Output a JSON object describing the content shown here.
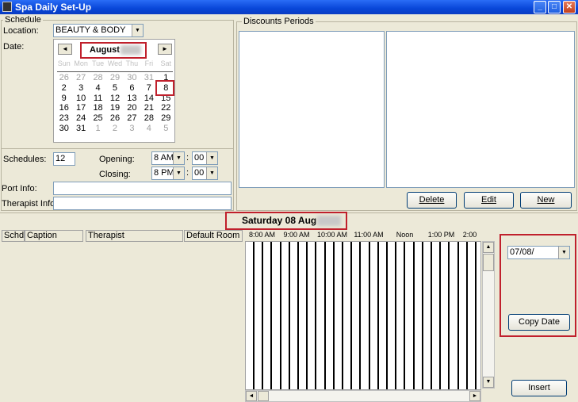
{
  "window": {
    "title": "Spa Daily Set-Up"
  },
  "schedule": {
    "group_label": "Schedule",
    "location_label": "Location:",
    "location_value": "BEAUTY & BODY",
    "date_label": "Date:",
    "calendar": {
      "month": "August",
      "dows": [
        "Sun",
        "Mon",
        "Tue",
        "Wed",
        "Thu",
        "Fri",
        "Sat"
      ],
      "days": [
        "26",
        "27",
        "28",
        "29",
        "30",
        "31",
        "1",
        "2",
        "3",
        "4",
        "5",
        "6",
        "7",
        "8",
        "9",
        "10",
        "11",
        "12",
        "13",
        "14",
        "15",
        "16",
        "17",
        "18",
        "19",
        "20",
        "21",
        "22",
        "23",
        "24",
        "25",
        "26",
        "27",
        "28",
        "29",
        "30",
        "31",
        "1",
        "2",
        "3",
        "4",
        "5"
      ],
      "selected_day": "8"
    },
    "schedules_label": "Schedules:",
    "schedules_value": "12",
    "opening_label": "Opening:",
    "opening_hour": "8 AM",
    "opening_min": "00",
    "closing_label": "Closing:",
    "closing_hour": "8 PM",
    "closing_min": "00",
    "port_label": "Port Info:",
    "therapist_label": "Therapist Info:"
  },
  "discounts": {
    "group_label": "Discounts Periods",
    "delete_label": "Delete",
    "edit_label": "Edit",
    "new_label": "New"
  },
  "date_header": "Saturday 08 Aug",
  "columns": [
    "Schd",
    "Caption",
    "Therapist",
    "Default Room"
  ],
  "times": [
    "8:00 AM",
    "9:00 AM",
    "10:00 AM",
    "11:00 AM",
    "Noon",
    "1:00 PM",
    "2:00"
  ],
  "copy": {
    "date_value": "07/08/",
    "copy_label": "Copy Date"
  },
  "insert_label": "Insert"
}
